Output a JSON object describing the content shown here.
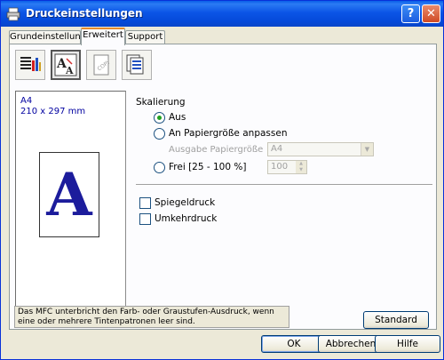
{
  "window": {
    "title": "Druckeinstellungen",
    "help_label": "?",
    "close_label": "✕"
  },
  "tabs": [
    {
      "label": "Grundeinstellungen"
    },
    {
      "label": "Erweitert"
    },
    {
      "label": "Support"
    }
  ],
  "preview": {
    "paper": "A4",
    "dimensions": "210 x 297 mm",
    "letter": "A"
  },
  "scaling": {
    "heading": "Skalierung",
    "option_off": "Aus",
    "option_fit": "An Papiergröße anpassen",
    "output_label": "Ausgabe Papiergröße",
    "output_value": "A4",
    "option_free": "Frei [25 - 100 %]",
    "free_value": "100"
  },
  "options": {
    "mirror": "Spiegeldruck",
    "reverse": "Umkehrdruck"
  },
  "info_text": "Das MFC unterbricht den Farb- oder Graustufen-Ausdruck, wenn eine oder mehrere Tintenpatronen leer sind.",
  "buttons": {
    "default": "Standard",
    "ok": "OK",
    "cancel": "Abbrechen",
    "help": "Hilfe"
  }
}
